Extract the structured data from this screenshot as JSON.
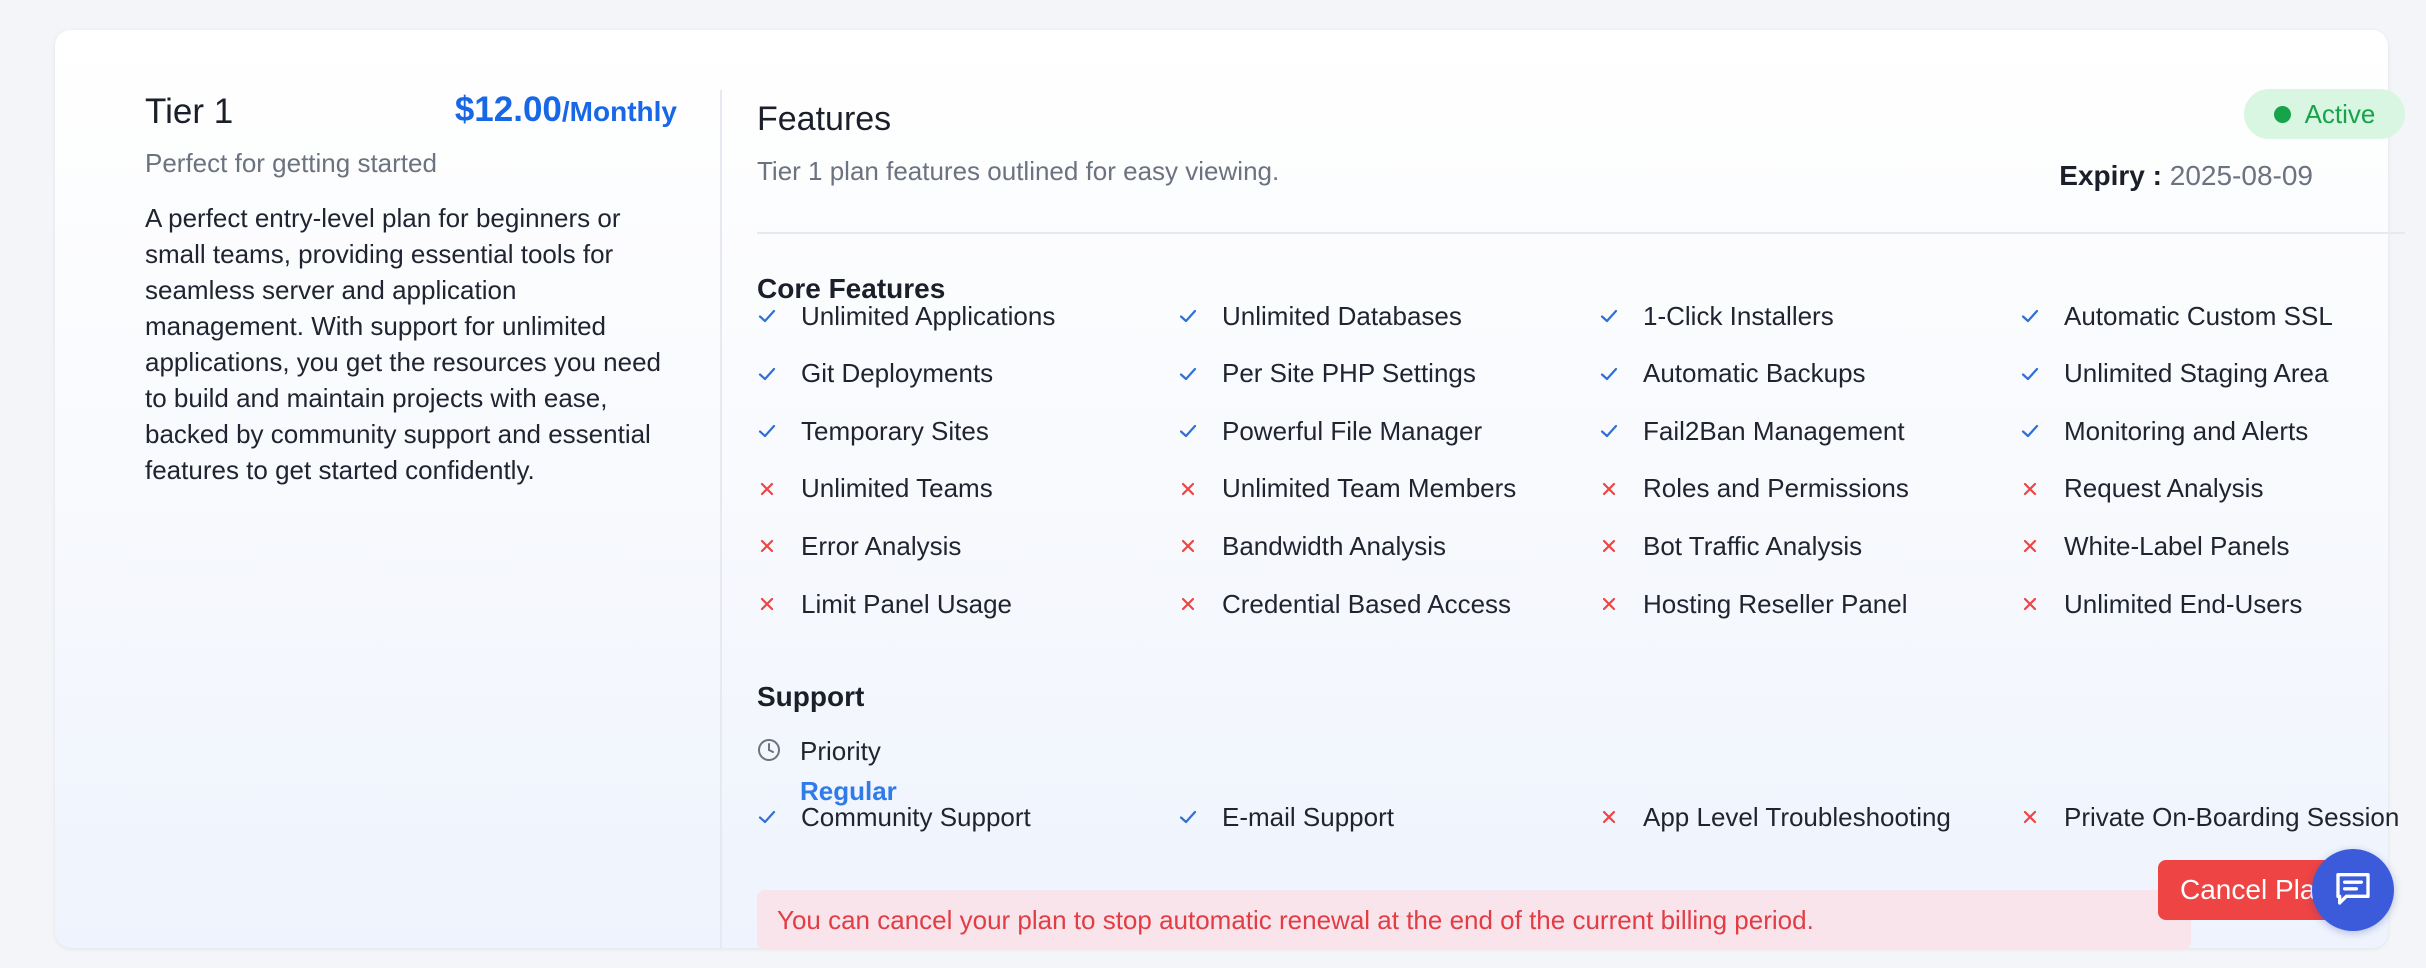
{
  "plan": {
    "name": "Tier 1",
    "price": "$12.00",
    "period": "/Monthly",
    "tagline": "Perfect for getting started",
    "description": "A perfect entry-level plan for beginners or small teams, providing essential tools for seamless server and application management. With support for unlimited applications, you get the resources you need to build and maintain projects with ease, backed by community support and essential features to get started confidently."
  },
  "features_panel": {
    "title": "Features",
    "subtitle": "Tier 1 plan features outlined for easy viewing.",
    "status": "Active",
    "expiry_label": "Expiry :",
    "expiry_date": "2025-08-09"
  },
  "core": {
    "title": "Core Features",
    "items": [
      {
        "label": "Unlimited Applications",
        "included": true,
        "icon": "check-icon"
      },
      {
        "label": "Unlimited Databases",
        "included": true,
        "icon": "check-icon"
      },
      {
        "label": "1-Click Installers",
        "included": true,
        "icon": "check-icon"
      },
      {
        "label": "Automatic Custom SSL",
        "included": true,
        "icon": "check-icon"
      },
      {
        "label": "Git Deployments",
        "included": true,
        "icon": "check-icon"
      },
      {
        "label": "Per Site PHP Settings",
        "included": true,
        "icon": "check-icon"
      },
      {
        "label": "Automatic Backups",
        "included": true,
        "icon": "check-icon"
      },
      {
        "label": "Unlimited Staging Area",
        "included": true,
        "icon": "check-icon"
      },
      {
        "label": "Temporary Sites",
        "included": true,
        "icon": "check-icon"
      },
      {
        "label": "Powerful File Manager",
        "included": true,
        "icon": "check-icon"
      },
      {
        "label": "Fail2Ban Management",
        "included": true,
        "icon": "check-icon"
      },
      {
        "label": "Monitoring and Alerts",
        "included": true,
        "icon": "check-icon"
      },
      {
        "label": "Unlimited Teams",
        "included": false,
        "icon": "cross-icon"
      },
      {
        "label": "Unlimited Team Members",
        "included": false,
        "icon": "cross-icon"
      },
      {
        "label": "Roles and Permissions",
        "included": false,
        "icon": "cross-icon"
      },
      {
        "label": "Request Analysis",
        "included": false,
        "icon": "cross-icon"
      },
      {
        "label": "Error Analysis",
        "included": false,
        "icon": "cross-icon"
      },
      {
        "label": "Bandwidth Analysis",
        "included": false,
        "icon": "cross-icon"
      },
      {
        "label": "Bot Traffic Analysis",
        "included": false,
        "icon": "cross-icon"
      },
      {
        "label": "White-Label Panels",
        "included": false,
        "icon": "cross-icon"
      },
      {
        "label": "Limit Panel Usage",
        "included": false,
        "icon": "cross-icon"
      },
      {
        "label": "Credential Based Access",
        "included": false,
        "icon": "cross-icon"
      },
      {
        "label": "Hosting Reseller Panel",
        "included": false,
        "icon": "cross-icon"
      },
      {
        "label": "Unlimited End-Users",
        "included": false,
        "icon": "cross-icon"
      }
    ]
  },
  "support": {
    "title": "Support",
    "priority_label": "Priority",
    "priority_value": "Regular",
    "priority_icon": "clock-icon",
    "items": [
      {
        "label": "Community Support",
        "included": true,
        "icon": "check-icon"
      },
      {
        "label": "E-mail Support",
        "included": true,
        "icon": "check-icon"
      },
      {
        "label": "App Level Troubleshooting",
        "included": false,
        "icon": "cross-icon"
      },
      {
        "label": "Private On-Boarding Session",
        "included": false,
        "icon": "cross-icon"
      }
    ]
  },
  "notice": "You can cancel your plan to stop automatic renewal at the end of the current billing period.",
  "cancel_button": "Cancel Plan",
  "chat_icon": "chat-icon",
  "colors": {
    "check": "#2f6fd6",
    "cross": "#ef4444",
    "accent": "#1767e6",
    "active": "#16a34a"
  }
}
